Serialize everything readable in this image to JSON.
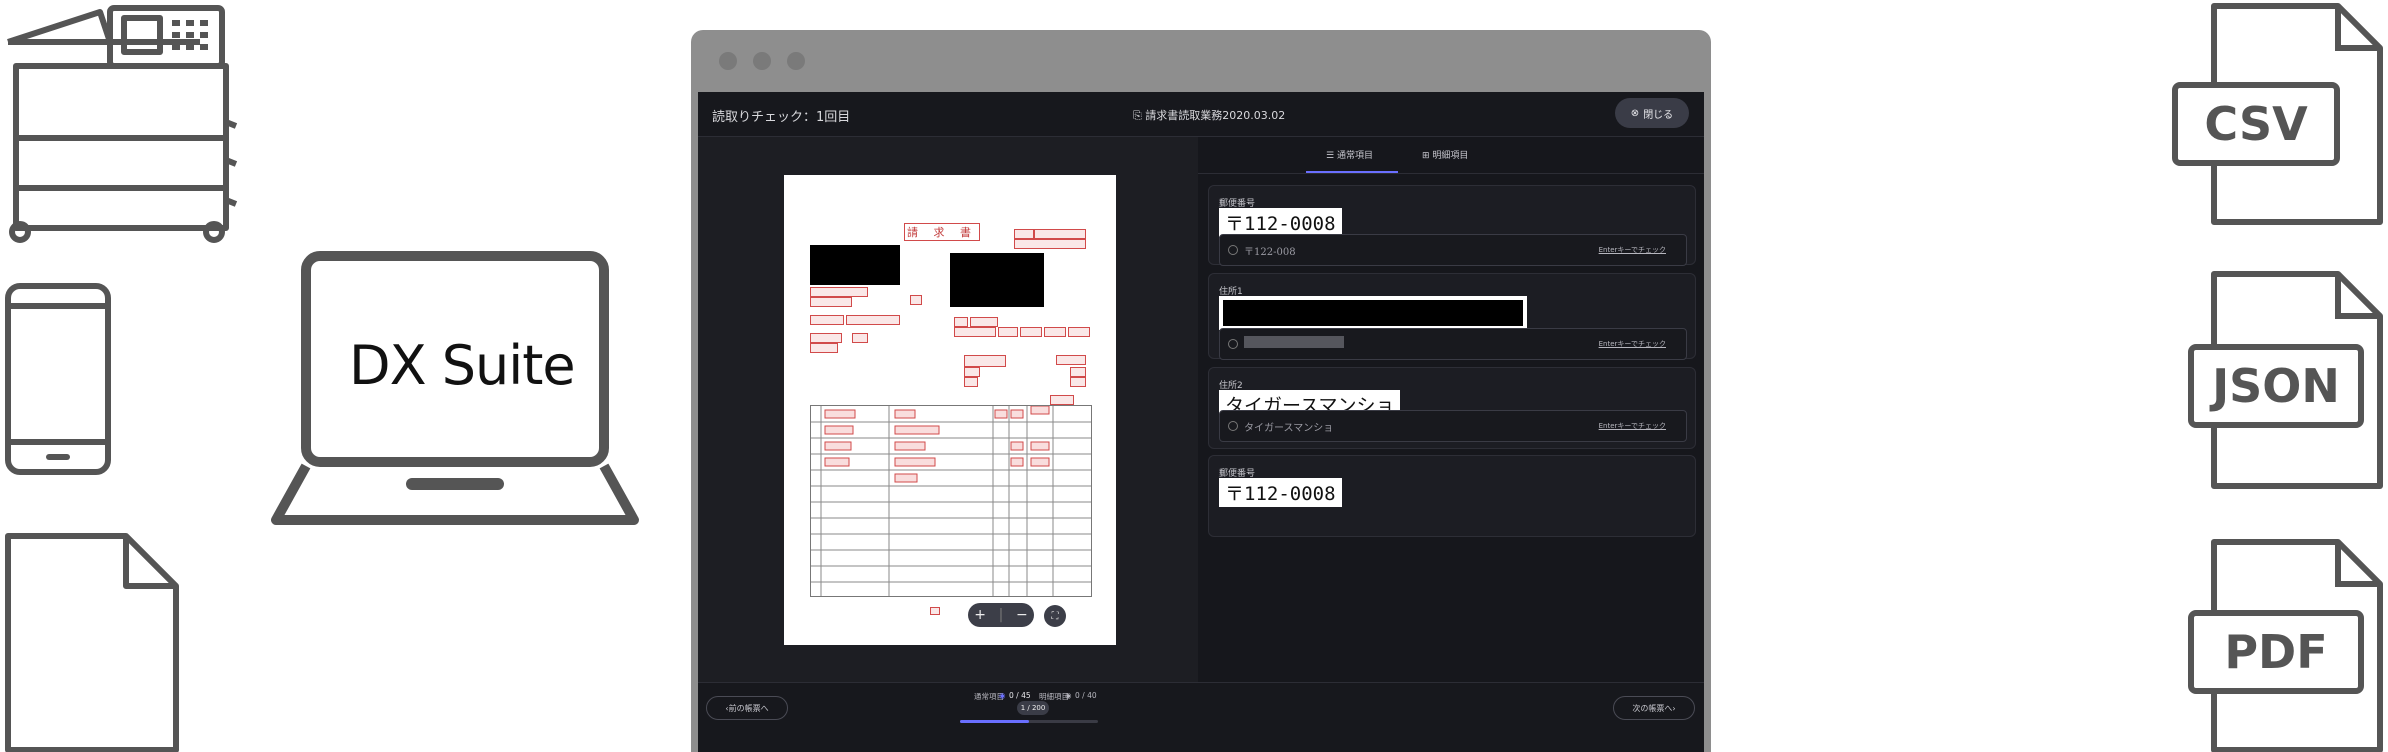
{
  "brand_text": "DX Suite",
  "output_formats": [
    "CSV",
    "JSON",
    "PDF"
  ],
  "app": {
    "header": {
      "title": "読取りチェック：1回目",
      "document_name": "請求書読取業務2020.03.02",
      "close_label": "閉じる"
    },
    "tabs": [
      {
        "label": "通常項目",
        "active": true
      },
      {
        "label": "明細項目",
        "active": false
      }
    ],
    "document_preview": {
      "title": "請 求 書"
    },
    "fields": [
      {
        "label": "郵便番号",
        "extracted_text": "〒112-0008",
        "input_value": "〒122-008",
        "hint": "Enterキーでチェック",
        "redacted": false
      },
      {
        "label": "住所1",
        "extracted_text": "",
        "input_value": "",
        "hint": "Enterキーでチェック",
        "redacted": true
      },
      {
        "label": "住所2",
        "extracted_text": "タイガースマンショ",
        "input_value": "タイガースマンショ",
        "hint": "Enterキーでチェック",
        "redacted": false
      },
      {
        "label": "郵便番号",
        "extracted_text": "〒112-0008"
      }
    ],
    "footer": {
      "prev_label": "前の帳票へ",
      "next_label": "次の帳票へ",
      "normal_items_label": "通常項目",
      "normal_items_count": "0 / 45",
      "detail_items_label": "明細項目",
      "detail_items_count": "0 / 40",
      "page": "1 / 200",
      "progress": 0.5
    }
  },
  "colors": {
    "accent": "#6a6fff",
    "panel_dark": "#16171c",
    "icon_gray": "#555555"
  }
}
